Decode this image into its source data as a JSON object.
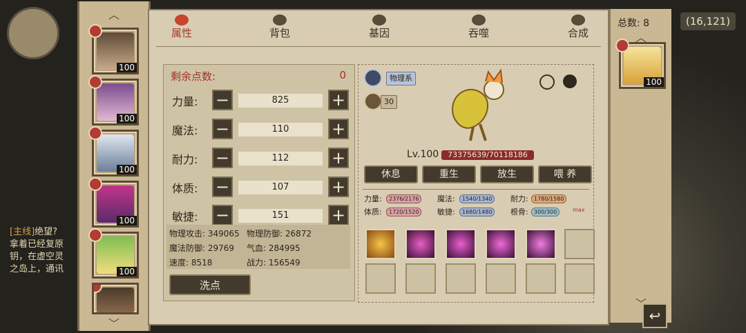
{
  "background": {
    "coord": "(16,121)",
    "quest_tag": "[主线]",
    "quest_title": "绝望?",
    "quest_lines": [
      "拿着已经复原",
      "钥，在虚空灵",
      "之岛上，通讯"
    ]
  },
  "roster": {
    "levels": [
      "100",
      "100",
      "100",
      "100",
      "100"
    ]
  },
  "tabs": [
    {
      "label": "属性"
    },
    {
      "label": "背包"
    },
    {
      "label": "基因"
    },
    {
      "label": "吞噬"
    },
    {
      "label": "合成"
    }
  ],
  "attributes": {
    "remaining_label": "剩余点数:",
    "remaining_value": "0",
    "rows": [
      {
        "label": "力量:",
        "value": "825"
      },
      {
        "label": "魔法:",
        "value": "110"
      },
      {
        "label": "耐力:",
        "value": "112"
      },
      {
        "label": "体质:",
        "value": "107"
      },
      {
        "label": "敏捷:",
        "value": "151"
      }
    ],
    "minus": "−",
    "plus": "+",
    "stats": [
      {
        "label": "物理攻击: 349065"
      },
      {
        "label": "物理防御: 26872"
      },
      {
        "label": "魔法防御: 29769"
      },
      {
        "label": "气血: 284995"
      },
      {
        "label": "速度: 8518"
      },
      {
        "label": "战力: 156549"
      }
    ],
    "wash_label": "洗点"
  },
  "info": {
    "type_label": "物理系",
    "paw_value": "30",
    "level": "Lv.100",
    "hp": "73375639/70118186",
    "actions": [
      "休息",
      "重生",
      "放生",
      "喂 养"
    ],
    "attrs": [
      {
        "label": "力量:",
        "value": "2376/2176",
        "color": "pink"
      },
      {
        "label": "魔法:",
        "value": "1540/1340",
        "color": "blue"
      },
      {
        "label": "耐力:",
        "value": "1780/1580",
        "color": "orange"
      },
      {
        "label": "体质:",
        "value": "1720/1520",
        "color": "pink"
      },
      {
        "label": "敏捷:",
        "value": "1680/1480",
        "color": "blue"
      },
      {
        "label": "根骨:",
        "value": "300/300",
        "color": "teal"
      }
    ],
    "max_label": "max"
  },
  "strip": {
    "total": "总数: 8",
    "level": "100"
  },
  "colors": {
    "accent": "#a63123",
    "panel": "#d8cdb3",
    "button": "#423a2c"
  }
}
